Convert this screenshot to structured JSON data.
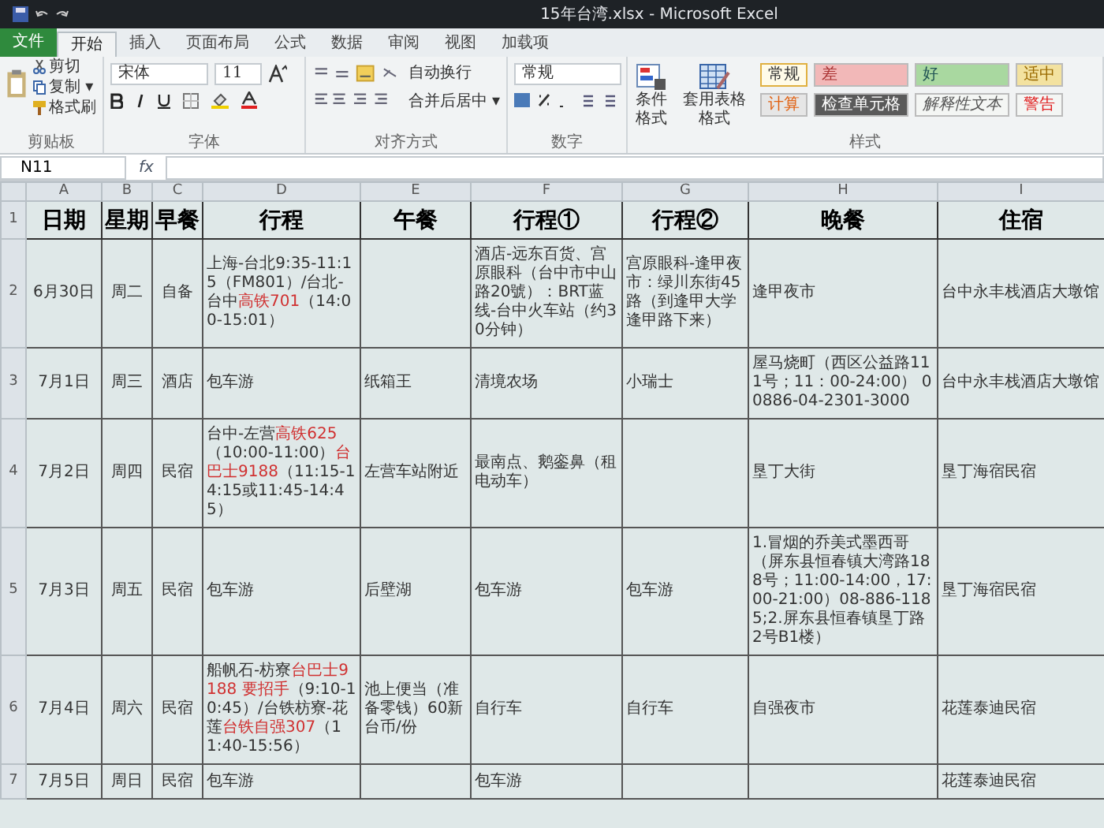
{
  "window": {
    "title": "15年台湾.xlsx - Microsoft Excel"
  },
  "tabs": [
    {
      "label": "文件",
      "selected": false,
      "kind": "file"
    },
    {
      "label": "开始",
      "selected": true,
      "kind": "tab"
    },
    {
      "label": "插入",
      "selected": false,
      "kind": "tab"
    },
    {
      "label": "页面布局",
      "selected": false,
      "kind": "tab"
    },
    {
      "label": "公式",
      "selected": false,
      "kind": "tab"
    },
    {
      "label": "数据",
      "selected": false,
      "kind": "tab"
    },
    {
      "label": "审阅",
      "selected": false,
      "kind": "tab"
    },
    {
      "label": "视图",
      "selected": false,
      "kind": "tab"
    },
    {
      "label": "加载项",
      "selected": false,
      "kind": "tab"
    }
  ],
  "ribbon": {
    "clipboard": {
      "label": "剪贴板",
      "cut": "剪切",
      "copy": "复制 ▾",
      "format_painter": "格式刷"
    },
    "font": {
      "label": "字体",
      "font_name": "宋体",
      "font_size": "11"
    },
    "alignment": {
      "label": "对齐方式",
      "wrap_text": "自动换行",
      "merge_center": "合并后居中 ▾"
    },
    "number": {
      "label": "数字",
      "format": "常规"
    },
    "styles": {
      "label": "样式",
      "conditional": "条件格式",
      "table_format": "套用表格格式",
      "cells": [
        {
          "label": "常规",
          "color": "#fffbe8"
        },
        {
          "label": "差",
          "color": "#f2b8b8"
        },
        {
          "label": "好",
          "color": "#a9d8a0"
        },
        {
          "label": "适中",
          "color": "#f3e2a0"
        },
        {
          "label": "计算",
          "color": "#e6e6e6"
        },
        {
          "label": "检查单元格",
          "color": "#5a5a5a"
        },
        {
          "label": "解释性文本",
          "color": "#f4f6f4"
        },
        {
          "label": "警告",
          "color": "#f4f6f4"
        }
      ]
    }
  },
  "formula_bar": {
    "name_box": "N11",
    "fx": "fx"
  },
  "table": {
    "columns": [
      "A",
      "B",
      "C",
      "D",
      "E",
      "F",
      "G",
      "H",
      "I"
    ],
    "header": {
      "row_number": "1",
      "cells": [
        "日期",
        "星期",
        "早餐",
        "行程",
        "午餐",
        "行程①",
        "行程②",
        "晚餐",
        "住宿"
      ]
    },
    "rows": [
      {
        "row_number": "2",
        "cells": [
          [
            {
              "text": "6月30日",
              "red": false
            }
          ],
          [
            {
              "text": "周二",
              "red": false
            }
          ],
          [
            {
              "text": "自备",
              "red": false
            }
          ],
          [
            {
              "text": "上海-台北9:35-11:15（FM801）/台北-台中",
              "red": false
            },
            {
              "text": "高铁701",
              "red": true
            },
            {
              "text": "（14:00-15:01）",
              "red": false
            }
          ],
          [],
          [
            {
              "text": "酒店-远东百货、宫原眼科（台中市中山路20號）：BRT蓝线-台中火车站（约30分钟）",
              "red": false
            }
          ],
          [
            {
              "text": "宫原眼科-逢甲夜市：绿川东街45路（到逢甲大学逢甲路下来）",
              "red": false
            }
          ],
          [
            {
              "text": "逢甲夜市",
              "red": false
            }
          ],
          [
            {
              "text": "台中永丰栈酒店大墩馆",
              "red": false
            }
          ]
        ]
      },
      {
        "row_number": "3",
        "cells": [
          [
            {
              "text": "7月1日",
              "red": false
            }
          ],
          [
            {
              "text": "周三",
              "red": false
            }
          ],
          [
            {
              "text": "酒店",
              "red": false
            }
          ],
          [
            {
              "text": "包车游",
              "red": false
            }
          ],
          [
            {
              "text": "纸箱王",
              "red": false
            }
          ],
          [
            {
              "text": "清境农场",
              "red": false
            }
          ],
          [
            {
              "text": "小瑞士",
              "red": false
            }
          ],
          [
            {
              "text": "屋马烧町（西区公益路111号；11：00-24:00） 00886-04-2301-3000",
              "red": false
            }
          ],
          [
            {
              "text": "台中永丰栈酒店大墩馆",
              "red": false
            }
          ]
        ]
      },
      {
        "row_number": "4",
        "cells": [
          [
            {
              "text": "7月2日",
              "red": false
            }
          ],
          [
            {
              "text": "周四",
              "red": false
            }
          ],
          [
            {
              "text": "民宿",
              "red": false
            }
          ],
          [
            {
              "text": "台中-左营",
              "red": false
            },
            {
              "text": "高铁625",
              "red": true
            },
            {
              "text": "（10:00-11:00）",
              "red": false
            },
            {
              "text": "台巴士9188",
              "red": true
            },
            {
              "text": "（11:15-14:15或11:45-14:45）",
              "red": false
            }
          ],
          [
            {
              "text": "左营车站附近",
              "red": false
            }
          ],
          [
            {
              "text": "最南点、鹅銮鼻（租电动车）",
              "red": false
            }
          ],
          [],
          [
            {
              "text": "垦丁大街",
              "red": false
            }
          ],
          [
            {
              "text": "垦丁海宿民宿",
              "red": false
            }
          ]
        ]
      },
      {
        "row_number": "5",
        "cells": [
          [
            {
              "text": "7月3日",
              "red": false
            }
          ],
          [
            {
              "text": "周五",
              "red": false
            }
          ],
          [
            {
              "text": "民宿",
              "red": false
            }
          ],
          [
            {
              "text": "包车游",
              "red": false
            }
          ],
          [
            {
              "text": "后壁湖",
              "red": false
            }
          ],
          [
            {
              "text": "包车游",
              "red": false
            }
          ],
          [
            {
              "text": "包车游",
              "red": false
            }
          ],
          [
            {
              "text": "1.冒烟的乔美式墨西哥（屏东县恒春镇大湾路188号；11:00-14:00，17:00-21:00）08-886-1185;2.屏东县恒春镇垦丁路2号B1楼）",
              "red": false
            }
          ],
          [
            {
              "text": "垦丁海宿民宿",
              "red": false
            }
          ]
        ]
      },
      {
        "row_number": "6",
        "cells": [
          [
            {
              "text": "7月4日",
              "red": false
            }
          ],
          [
            {
              "text": "周六",
              "red": false
            }
          ],
          [
            {
              "text": "民宿",
              "red": false
            }
          ],
          [
            {
              "text": "船帆石-枋寮",
              "red": false
            },
            {
              "text": "台巴士9188 要招手",
              "red": true
            },
            {
              "text": "（9:10-10:45）/台铁枋寮-花莲",
              "red": false
            },
            {
              "text": "台铁自强307",
              "red": true
            },
            {
              "text": "（11:40-15:56）",
              "red": false
            }
          ],
          [
            {
              "text": "池上便当（准备零钱）60新台币/份",
              "red": false
            }
          ],
          [
            {
              "text": "自行车",
              "red": false
            }
          ],
          [
            {
              "text": "自行车",
              "red": false
            }
          ],
          [
            {
              "text": "自强夜市",
              "red": false
            }
          ],
          [
            {
              "text": "花莲泰迪民宿",
              "red": false
            }
          ]
        ]
      },
      {
        "row_number": "7",
        "cells": [
          [
            {
              "text": "7月5日",
              "red": false
            }
          ],
          [
            {
              "text": "周日",
              "red": false
            }
          ],
          [
            {
              "text": "民宿",
              "red": false
            }
          ],
          [
            {
              "text": "包车游",
              "red": false
            }
          ],
          [],
          [
            {
              "text": "包车游",
              "red": false
            }
          ],
          [],
          [],
          [
            {
              "text": "花莲泰迪民宿",
              "red": false
            }
          ]
        ]
      }
    ]
  }
}
